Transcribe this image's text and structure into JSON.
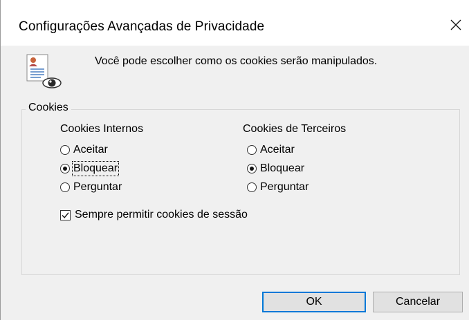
{
  "window": {
    "title": "Configurações Avançadas de Privacidade",
    "close_symbol": "✕"
  },
  "header": {
    "icon": "privacy-document-eye-icon",
    "intro": "Você pode escolher como os cookies serão manipulados."
  },
  "cookies_group": {
    "legend": "Cookies",
    "first_party": {
      "heading": "Cookies Internos",
      "options": [
        "Aceitar",
        "Bloquear",
        "Perguntar"
      ],
      "selected": "Bloquear"
    },
    "third_party": {
      "heading": "Cookies de Terceiros",
      "options": [
        "Aceitar",
        "Bloquear",
        "Perguntar"
      ],
      "selected": "Bloquear"
    },
    "session_checkbox": {
      "label": "Sempre permitir cookies de sessão",
      "checked": true
    }
  },
  "buttons": {
    "ok": "OK",
    "cancel": "Cancelar"
  },
  "colors": {
    "dialog_bg": "#f0f0f0",
    "titlebar_bg": "#ffffff",
    "default_button_border": "#0078d7"
  }
}
